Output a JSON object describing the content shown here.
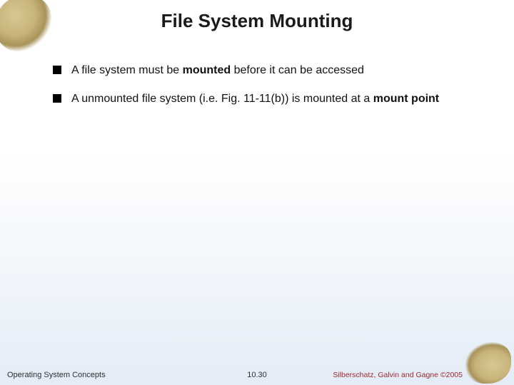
{
  "title": "File System Mounting",
  "bullets": [
    {
      "pre": "A file system must be ",
      "b1": "mounted",
      "post": " before it can be accessed"
    },
    {
      "pre": "A unmounted file system (i.e. Fig. 11-11(b)) is mounted at a ",
      "b1": "mount point",
      "post": ""
    }
  ],
  "footer": {
    "left": "Operating System Concepts",
    "center": "10.30",
    "right": "Silberschatz, Galvin and Gagne ©2005"
  }
}
